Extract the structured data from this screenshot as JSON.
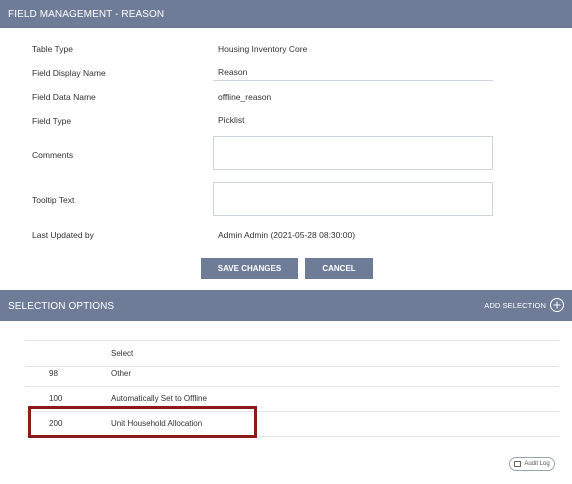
{
  "header": {
    "title": "FIELD MANAGEMENT - REASON"
  },
  "form": {
    "table_type": {
      "label": "Table Type",
      "value": "Housing Inventory Core"
    },
    "field_display_name": {
      "label": "Field Display Name",
      "value": "Reason"
    },
    "field_data_name": {
      "label": "Field Data Name",
      "value": "offline_reason"
    },
    "field_type": {
      "label": "Field Type",
      "value": "Picklist"
    },
    "comments": {
      "label": "Comments",
      "value": ""
    },
    "tooltip_text": {
      "label": "Tooltip Text",
      "value": ""
    },
    "last_updated_by": {
      "label": "Last Updated by",
      "value": "Admin Admin (2021-05-28 08:30:00)"
    }
  },
  "buttons": {
    "save": "SAVE CHANGES",
    "cancel": "CANCEL"
  },
  "selection_options": {
    "title": "SELECTION OPTIONS",
    "add_label": "ADD SELECTION",
    "header_select": "Select",
    "rows": [
      {
        "value": "98",
        "label": "Other"
      },
      {
        "value": "100",
        "label": "Automatically Set to Offline"
      },
      {
        "value": "200",
        "label": "Unit Household Allocation"
      }
    ]
  },
  "audit_log": {
    "label": "Audit Log"
  },
  "colors": {
    "bar": "#6f7c98",
    "highlight": "#8b1a1a"
  }
}
